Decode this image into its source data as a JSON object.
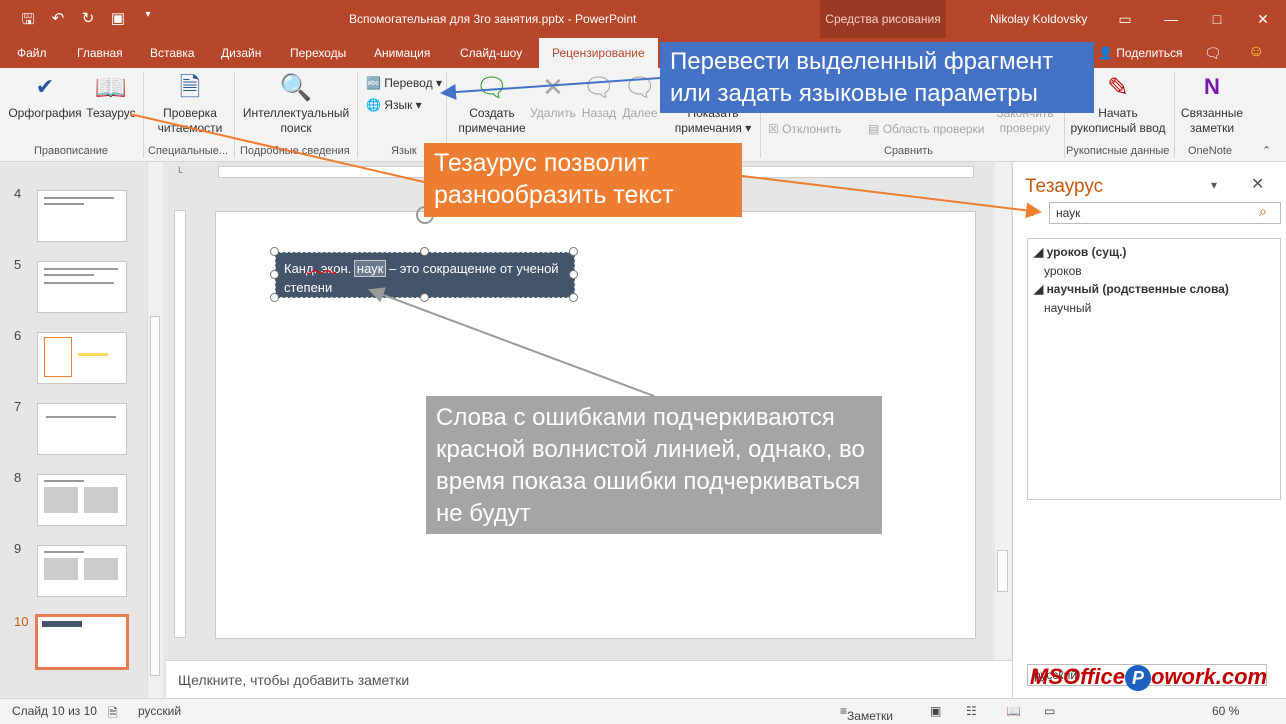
{
  "titlebar": {
    "document_title": "Вспомогательная для 3го занятия.pptx  -  PowerPoint",
    "context_tab": "Средства рисования",
    "user": "Nikolay Koldovsky",
    "qat_icons": [
      "save-icon",
      "undo-icon",
      "redo-icon",
      "present-icon",
      "customize-icon"
    ]
  },
  "tabs": {
    "items": [
      "Файл",
      "Главная",
      "Вставка",
      "Дизайн",
      "Переходы",
      "Анимация",
      "Слайд-шоу",
      "Рецензирование"
    ],
    "active": "Рецензирование",
    "share": "Поделиться"
  },
  "ribbon": {
    "spelling": "Орфография",
    "thesaurus": "Тезаурус",
    "group_proofing": "Правописание",
    "accessibility_line1": "Проверка",
    "accessibility_line2": "читаемости",
    "group_special": "Специальные...",
    "smart_lookup_line1": "Интеллектуальный",
    "smart_lookup_line2": "поиск",
    "group_insights": "Подробные сведения",
    "translate": "Перевод",
    "language": "Язык",
    "group_language": "Язык",
    "new_comment_line1": "Создать",
    "new_comment_line2": "примечание",
    "delete": "Удалить",
    "previous": "Назад",
    "next": "Далее",
    "show_comments_line1": "Показать",
    "show_comments_line2": "примечания",
    "reject": "Отклонить",
    "reviewing_pane": "Область проверки",
    "end_review_line1": "Закончить",
    "end_review_line2": "проверку",
    "group_compare": "Сравнить",
    "start_inking_line1": "Начать",
    "start_inking_line2": "рукописный ввод",
    "group_ink": "Рукописные данные",
    "linked_notes_line1": "Связанные",
    "linked_notes_line2": "заметки",
    "group_onenote": "OneNote"
  },
  "slides": {
    "numbers": [
      "4",
      "5",
      "6",
      "7",
      "8",
      "9",
      "10"
    ],
    "active": "10"
  },
  "editor": {
    "textbox_before": "Канд. экон. ",
    "textbox_word": "наук",
    "textbox_after": " – это сокращение от ученой степени",
    "notes_placeholder": "Щелкните, чтобы добавить заметки"
  },
  "thesaurus": {
    "title": "Тезаурус",
    "search_value": "наук",
    "items": [
      {
        "text": "уроков (сущ.)",
        "bold": true
      },
      {
        "text": "уроков",
        "bold": false
      },
      {
        "text": "научный (родственные слова)",
        "bold": true
      },
      {
        "text": "научный",
        "bold": false
      }
    ],
    "language": "русский"
  },
  "status": {
    "slide_info": "Слайд 10 из 10",
    "language": "русский",
    "notes": "Заметки",
    "zoom": "60 %"
  },
  "callouts": {
    "blue": "Перевести выделенный фрагмент или задать языковые параметры",
    "orange": "Тезаурус позволит разнообразить текст",
    "gray": "Слова с ошибками подчеркиваются красной волнистой линией, однако, во время показа ошибки подчеркиваться не будут"
  },
  "watermark": {
    "left": "MSOffice",
    "p": "P",
    "right": "owork.com"
  },
  "colors": {
    "brand": "#b7472a",
    "callout_blue": "#4472c4",
    "callout_orange": "#ed7d31",
    "callout_gray": "#a5a5a5",
    "textbox_fill": "#44546a"
  }
}
